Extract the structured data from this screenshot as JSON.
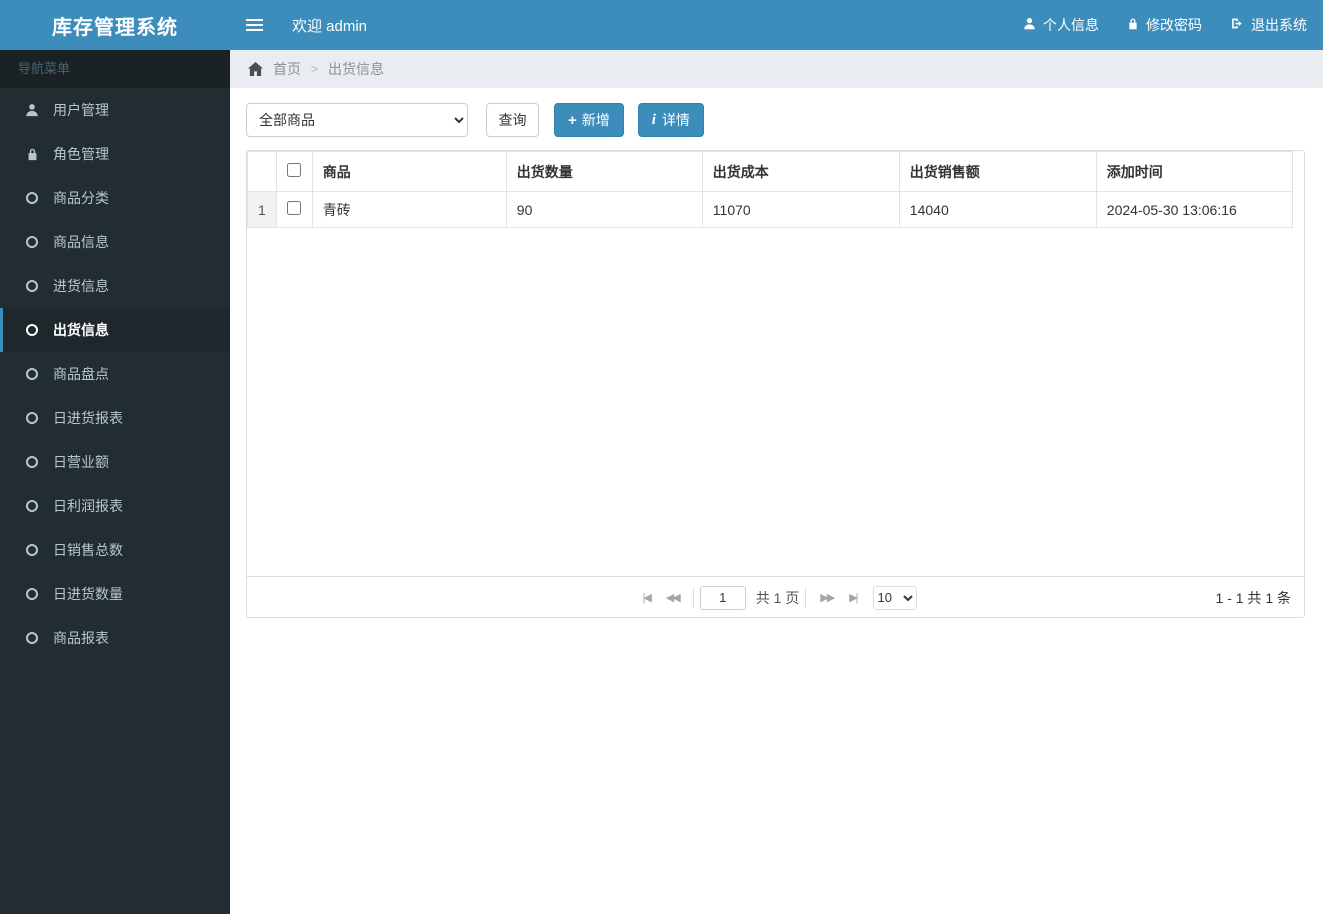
{
  "app": {
    "title": "库存管理系统",
    "nav_menu_label": "导航菜单"
  },
  "topbar": {
    "welcome": "欢迎 admin",
    "menu": [
      {
        "label": "个人信息",
        "icon": "user-icon"
      },
      {
        "label": "修改密码",
        "icon": "lock-icon"
      },
      {
        "label": "退出系统",
        "icon": "logout-icon"
      }
    ]
  },
  "breadcrumb": {
    "home": "首页",
    "separator": ">",
    "current": "出货信息"
  },
  "sidebar": {
    "items": [
      {
        "label": "用户管理",
        "icon": "user-icon",
        "active": false
      },
      {
        "label": "角色管理",
        "icon": "role-lock-icon",
        "active": false
      },
      {
        "label": "商品分类",
        "icon": "circle-icon",
        "active": false
      },
      {
        "label": "商品信息",
        "icon": "circle-icon",
        "active": false
      },
      {
        "label": "进货信息",
        "icon": "circle-icon",
        "active": false
      },
      {
        "label": "出货信息",
        "icon": "circle-icon",
        "active": true
      },
      {
        "label": "商品盘点",
        "icon": "circle-icon",
        "active": false
      },
      {
        "label": "日进货报表",
        "icon": "circle-icon",
        "active": false
      },
      {
        "label": "日营业额",
        "icon": "circle-icon",
        "active": false
      },
      {
        "label": "日利润报表",
        "icon": "circle-icon",
        "active": false
      },
      {
        "label": "日销售总数",
        "icon": "circle-icon",
        "active": false
      },
      {
        "label": "日进货数量",
        "icon": "circle-icon",
        "active": false
      },
      {
        "label": "商品报表",
        "icon": "circle-icon",
        "active": false
      }
    ]
  },
  "toolbar": {
    "filter_selected": "全部商品",
    "search_label": "查询",
    "add_label": "新增",
    "detail_label": "详情"
  },
  "table": {
    "headers": [
      "商品",
      "出货数量",
      "出货成本",
      "出货销售额",
      "添加时间"
    ],
    "rows": [
      {
        "index": "1",
        "product": "青砖",
        "qty": "90",
        "cost": "11070",
        "sales": "14040",
        "added_time": "2024-05-30 13:06:16"
      }
    ]
  },
  "pagination": {
    "first_icon": "|◀",
    "prev_icon": "◀◀",
    "page_value": "1",
    "total_pages_label": "共 1 页",
    "next_icon": "▶▶",
    "last_icon": "▶|",
    "page_size": "10",
    "range_label": "1 - 1  共 1 条"
  },
  "colors": {
    "accent_blue": "#3c8dbc",
    "sidebar_bg": "#222d32",
    "sidebar_active_bg": "#1e282c",
    "sidebar_text": "#b8c7ce",
    "breadcrumb_bg": "#e9edf2",
    "border": "#ddd",
    "row_index_bg": "#f2f2f2"
  }
}
